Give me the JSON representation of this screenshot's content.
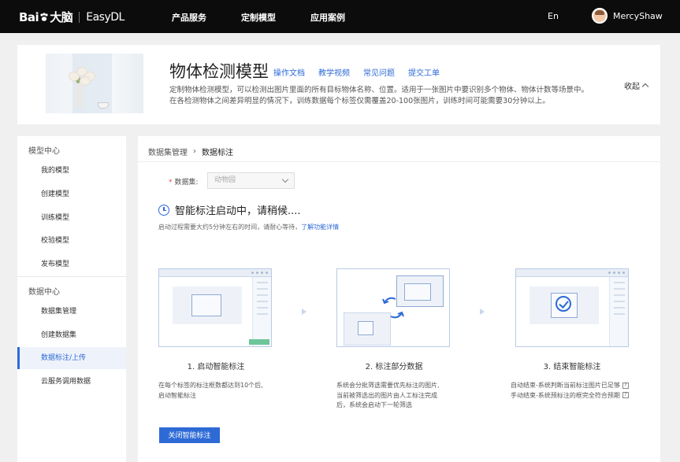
{
  "topbar": {
    "brand_part1": "Bai",
    "brand_part2": "大脑",
    "product": "EasyDL",
    "nav": [
      "产品服务",
      "定制模型",
      "应用案例"
    ],
    "lang": "En",
    "username": "MercyShaw"
  },
  "hero": {
    "title": "物体检测模型",
    "links": [
      "操作文档",
      "教学视频",
      "常见问题",
      "提交工单"
    ],
    "desc_line1": "定制物体检测模型，可以检测出图片里面的所有目标物体名称、位置。适用于一张图片中要识别多个物体、物体计数等场景中。",
    "desc_line2": "在各检测物体之间差异明显的情况下，训练数据每个标签仅需覆盖20-100张图片，训练时间可能需要30分钟以上。",
    "collapse": "收起"
  },
  "sidebar": {
    "group1": "模型中心",
    "group1_items": [
      "我的模型",
      "创建模型",
      "训练模型",
      "校验模型",
      "发布模型"
    ],
    "group2": "数据中心",
    "group2_items": [
      "数据集管理",
      "创建数据集",
      "数据标注/上传",
      "云服务调用数据"
    ],
    "active": "数据标注/上传"
  },
  "main": {
    "breadcrumb": [
      "数据集管理",
      "数据标注"
    ],
    "dataset_label": "数据集:",
    "dataset_value": "动物园",
    "status": "智能标注启动中，请稍候....",
    "hint_text": "启动过程需要大约5分钟左右的时间，请耐心等待，",
    "hint_link": "了解功能详情",
    "steps": [
      {
        "title": "1. 启动智能标注",
        "desc": [
          "在每个标签的标注框数都达到10个后,",
          "启动智能标注"
        ]
      },
      {
        "title": "2. 标注部分数据",
        "desc": [
          "系统会分批筛选需要优先标注的图片,",
          "当前被筛选出的图片由人工标注完成",
          "后，系统会启动下一轮筛选"
        ]
      },
      {
        "title": "3. 结束智能标注",
        "desc": [
          "自动结束-系统判断当前标注图片已足够",
          "手动结束-系统预标注的框完全符合预期"
        ]
      }
    ],
    "close_button": "关闭智能标注"
  },
  "colors": {
    "accent": "#2d6ad6",
    "topbar": "#0c0c0c",
    "required": "#e24a4a"
  }
}
